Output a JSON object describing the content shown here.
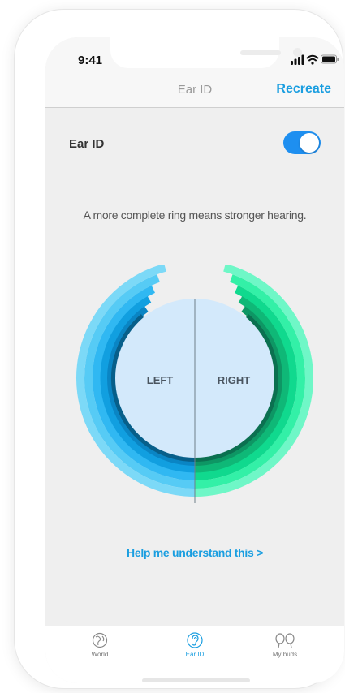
{
  "status_bar": {
    "time": "9:41",
    "icons": [
      "signal-icon",
      "wifi-icon",
      "battery-icon"
    ]
  },
  "nav": {
    "title": "Ear ID",
    "action_label": "Recreate"
  },
  "setting": {
    "label": "Ear ID",
    "toggle_on": true
  },
  "caption": "A more complete ring means stronger hearing.",
  "hearing_chart": {
    "left_label": "LEFT",
    "right_label": "RIGHT",
    "left_ring_colors": [
      "#7cd9f7",
      "#56cbf5",
      "#30b8f2",
      "#119fe0",
      "#0a85c4",
      "#075f8a"
    ],
    "right_ring_colors": [
      "#6ff7c7",
      "#33f0a7",
      "#10d98e",
      "#0fb877",
      "#0e9664",
      "#0b7050"
    ],
    "center_fill": "#d3e9fb"
  },
  "help_link": "Help me understand this >",
  "tabs": [
    {
      "label": "World",
      "icon": "globe-icon",
      "active": false
    },
    {
      "label": "Ear ID",
      "icon": "ear-icon",
      "active": true
    },
    {
      "label": "My buds",
      "icon": "earbuds-icon",
      "active": false
    }
  ],
  "colors": {
    "accent": "#1a9ee0",
    "toggle": "#1e8ff0",
    "background": "#efefef"
  }
}
